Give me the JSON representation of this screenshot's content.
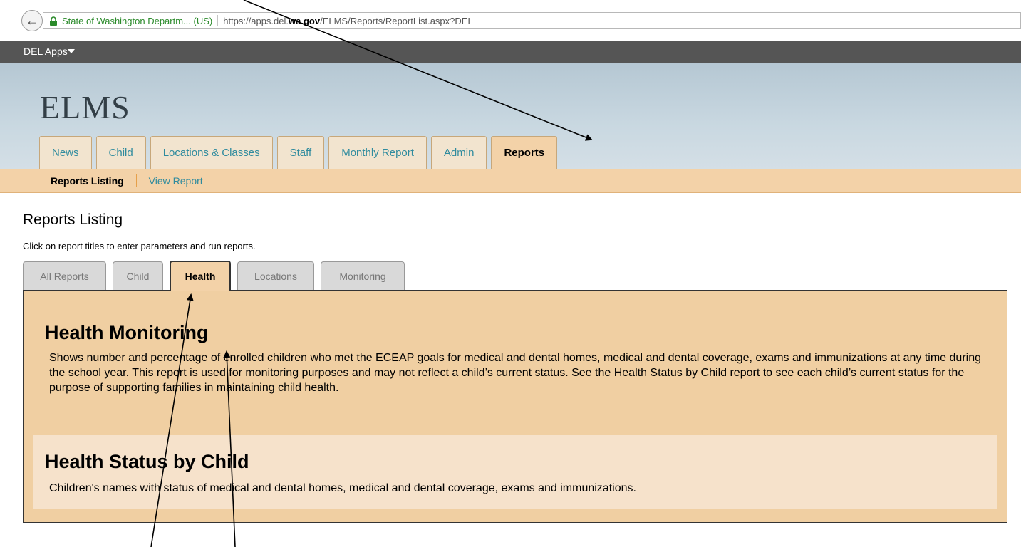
{
  "browser": {
    "site_identity": "State of Washington Departm... (US)",
    "url_prefix": "https://apps.del.",
    "url_domain": "wa.gov",
    "url_suffix": "/ELMS/Reports/ReportList.aspx?DEL"
  },
  "appbar": {
    "label": "DEL Apps"
  },
  "header": {
    "logo": "ELMS",
    "nav": [
      "News",
      "Child",
      "Locations & Classes",
      "Staff",
      "Monthly Report",
      "Admin",
      "Reports"
    ],
    "active_nav": "Reports"
  },
  "subnav": {
    "active": "Reports Listing",
    "link": "View Report"
  },
  "content": {
    "title": "Reports Listing",
    "intro": "Click on report titles to enter parameters and run reports.",
    "tabs": [
      "All Reports",
      "Child",
      "Health",
      "Locations",
      "Monitoring"
    ],
    "active_tab": "Health",
    "reports": [
      {
        "title": "Health Monitoring",
        "description": "Shows number and percentage of enrolled children who met the ECEAP goals for medical and dental homes, medical and dental coverage, exams and immunizations at any time during the school year. This report is used for monitoring purposes and may not reflect a child’s current status. See the Health Status by Child report to see each child’s current status for the purpose of supporting families in maintaining child health."
      },
      {
        "title": "Health Status by Child",
        "description": "Children's names with status of medical and dental homes, medical and dental coverage, exams and immunizations."
      }
    ]
  },
  "colors": {
    "tab_active": "#f3d2a8",
    "link": "#2f8b9e",
    "panel": "#f0cfa2",
    "appbar": "#555555"
  }
}
